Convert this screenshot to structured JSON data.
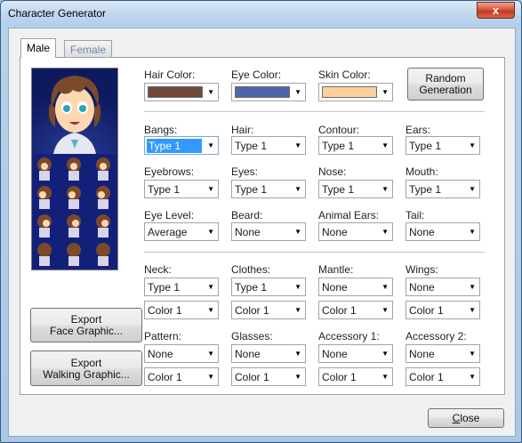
{
  "window": {
    "title": "Character Generator",
    "close_glyph": "x"
  },
  "tabs": [
    {
      "label": "Male",
      "active": true
    },
    {
      "label": "Female",
      "active": false
    }
  ],
  "colors": {
    "hair_label": "Hair Color:",
    "hair": "#6f4a38",
    "eye_label": "Eye Color:",
    "eye": "#4c66aa",
    "skin_label": "Skin Color:",
    "skin": "#ffd09e"
  },
  "random_button": {
    "line1": "Random",
    "line2": "Generation"
  },
  "rows": {
    "r1": [
      {
        "label": "Bangs:",
        "value": "Type 1",
        "selected": true
      },
      {
        "label": "Hair:",
        "value": "Type 1"
      },
      {
        "label": "Contour:",
        "value": "Type 1"
      },
      {
        "label": "Ears:",
        "value": "Type 1"
      }
    ],
    "r2": [
      {
        "label": "Eyebrows:",
        "value": "Type 1"
      },
      {
        "label": "Eyes:",
        "value": "Type 1"
      },
      {
        "label": "Nose:",
        "value": "Type 1"
      },
      {
        "label": "Mouth:",
        "value": "Type 1"
      }
    ],
    "r3": [
      {
        "label": "Eye Level:",
        "value": "Average"
      },
      {
        "label": "Beard:",
        "value": "None"
      },
      {
        "label": "Animal Ears:",
        "value": "None"
      },
      {
        "label": "Tail:",
        "value": "None"
      }
    ],
    "r4": [
      {
        "label": "Neck:",
        "value": "Type 1",
        "color": "Color 1"
      },
      {
        "label": "Clothes:",
        "value": "Type 1",
        "color": "Color 1"
      },
      {
        "label": "Mantle:",
        "value": "None",
        "color": "Color 1"
      },
      {
        "label": "Wings:",
        "value": "None",
        "color": "Color 1"
      }
    ],
    "r5": [
      {
        "label": "Pattern:",
        "value": "None",
        "color": "Color 1"
      },
      {
        "label": "Glasses:",
        "value": "None",
        "color": "Color 1"
      },
      {
        "label": "Accessory 1:",
        "value": "None",
        "color": "Color 1"
      },
      {
        "label": "Accessory 2:",
        "value": "None",
        "color": "Color 1"
      }
    ]
  },
  "export_face": {
    "line1": "Export",
    "line2": "Face Graphic..."
  },
  "export_walk": {
    "line1": "Export",
    "line2": "Walking Graphic..."
  },
  "close_button": {
    "label": "Close"
  },
  "icons": {
    "dropdown": "chevron-down-icon"
  }
}
